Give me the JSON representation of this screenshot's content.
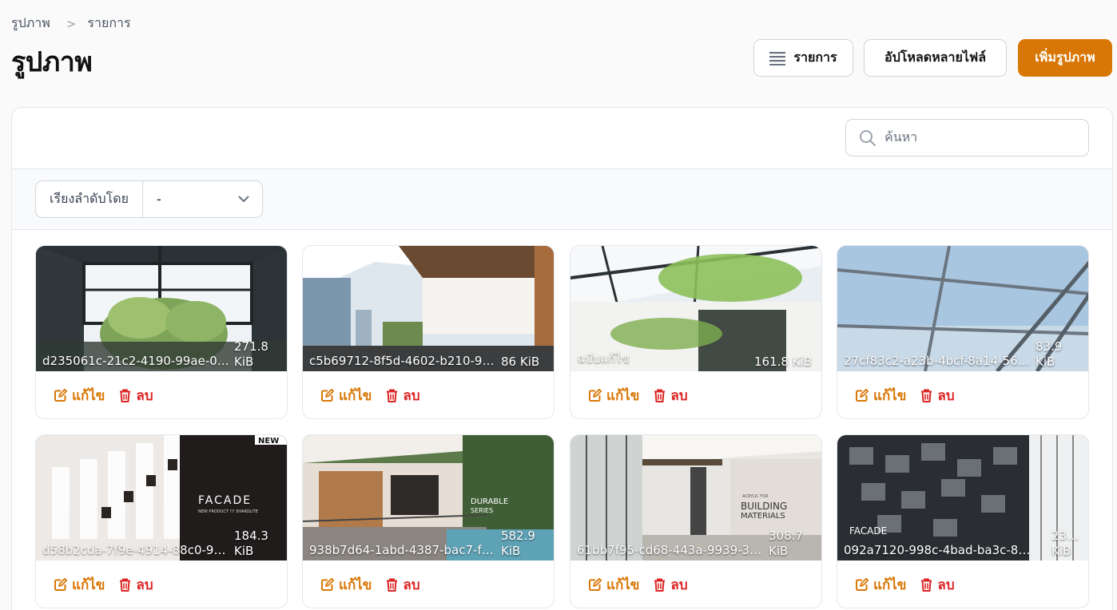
{
  "breadcrumb": {
    "parent": "รูปภาพ",
    "current": "รายการ"
  },
  "page_title": "รูปภาพ",
  "header_buttons": {
    "list": "รายการ",
    "upload": "อัปโหลดหลายไฟล์",
    "add": "เพิ่มรูปภาพ"
  },
  "search": {
    "placeholder": "ค้นหา"
  },
  "sort": {
    "label": "เรียงลำดับโดย",
    "value": "-"
  },
  "actions": {
    "edit": "แก้ไข",
    "delete": "ลบ"
  },
  "cards": [
    {
      "name": "d235061c-21c2-4190-99ae-0a…",
      "size": "271.8 KiB",
      "icon": "skylight-photo"
    },
    {
      "name": "c5b69712-8f5d-4602-b210-978…",
      "size": "86 KiB",
      "icon": "terrace-photo"
    },
    {
      "name": "ฉบับแก้ไข",
      "size": "161.8 KiB",
      "icon": "glass-roof-photo"
    },
    {
      "name": "27cf83c2-a23b-4bcf-8a14-56e…",
      "size": "83.9 KiB",
      "icon": "glass-roof-photo"
    },
    {
      "name": "d58b2cda-7f9e-4914-88c0-9…",
      "size": "184.3 KiB",
      "icon": "facade-photo",
      "overlay": [
        "NEW",
        "FACADE",
        "NEW PRODUCT !!! SHAKOLITE"
      ]
    },
    {
      "name": "938b7d64-1abd-4387-bac7-f…",
      "size": "582.9 KiB",
      "icon": "balcony-photo",
      "overlay": [
        "DURABLE",
        "SERIES"
      ]
    },
    {
      "name": "61bb7f95-cd68-443a-9939-3…",
      "size": "308.7 KiB",
      "icon": "corridor-photo",
      "overlay": [
        "ACRYLIC FOR",
        "BUILDING",
        "MATERIALS"
      ]
    },
    {
      "name": "092a7120-998c-4bad-ba3c-8…",
      "size": "23… KiB",
      "icon": "facade-panels-photo",
      "overlay": [
        "FACADE"
      ]
    }
  ]
}
